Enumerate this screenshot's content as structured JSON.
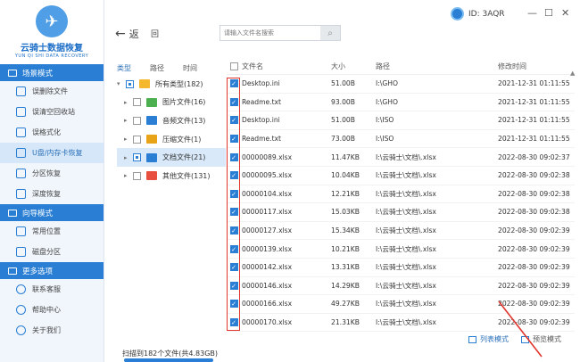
{
  "app": {
    "logo_title": "云骑士数据恢复",
    "logo_sub": "YUN QI SHI DATA RECOVERY",
    "user_id": "ID: 3AQR"
  },
  "sidebar": {
    "sections": [
      {
        "title": "场景模式",
        "items": [
          "误删除文件",
          "误清空回收站",
          "误格式化",
          "U盘/内存卡恢复",
          "分区恢复",
          "深度恢复"
        ]
      },
      {
        "title": "向导模式",
        "items": [
          "常用位置",
          "磁盘分区"
        ]
      },
      {
        "title": "更多选项",
        "items": [
          "联系客服",
          "帮助中心",
          "关于我们"
        ]
      }
    ]
  },
  "toolbar": {
    "back_label": "返",
    "back2_label": "回",
    "search_placeholder": "请输入文件名搜索"
  },
  "tree": {
    "headers": [
      "类型",
      "路径",
      "时间"
    ],
    "rows": [
      {
        "label": "所有类型(182)",
        "color": "#f5b72c"
      },
      {
        "label": "图片文件(16)",
        "color": "#4caf50"
      },
      {
        "label": "音频文件(13)",
        "color": "#2a7fd4"
      },
      {
        "label": "压缩文件(1)",
        "color": "#e8a317"
      },
      {
        "label": "文档文件(21)",
        "color": "#2a7fd4"
      },
      {
        "label": "其他文件(131)",
        "color": "#e94f3f"
      }
    ]
  },
  "table": {
    "headers": {
      "name": "文件名",
      "size": "大小",
      "path": "路径",
      "date": "修改时间"
    },
    "rows": [
      {
        "name": "Desktop.ini",
        "size": "51.00B",
        "path": "I:\\GHO",
        "date": "2021-12-31 01:11:55"
      },
      {
        "name": "Readme.txt",
        "size": "93.00B",
        "path": "I:\\GHO",
        "date": "2021-12-31 01:11:55"
      },
      {
        "name": "Desktop.ini",
        "size": "51.00B",
        "path": "I:\\ISO",
        "date": "2021-12-31 01:11:55"
      },
      {
        "name": "Readme.txt",
        "size": "73.00B",
        "path": "I:\\ISO",
        "date": "2021-12-31 01:11:55"
      },
      {
        "name": "00000089.xlsx",
        "size": "11.47KB",
        "path": "I:\\云骑士\\文档\\.xlsx",
        "date": "2022-08-30 09:02:37"
      },
      {
        "name": "00000095.xlsx",
        "size": "10.04KB",
        "path": "I:\\云骑士\\文档\\.xlsx",
        "date": "2022-08-30 09:02:38"
      },
      {
        "name": "00000104.xlsx",
        "size": "12.21KB",
        "path": "I:\\云骑士\\文档\\.xlsx",
        "date": "2022-08-30 09:02:38"
      },
      {
        "name": "00000117.xlsx",
        "size": "15.03KB",
        "path": "I:\\云骑士\\文档\\.xlsx",
        "date": "2022-08-30 09:02:38"
      },
      {
        "name": "00000127.xlsx",
        "size": "15.34KB",
        "path": "I:\\云骑士\\文档\\.xlsx",
        "date": "2022-08-30 09:02:39"
      },
      {
        "name": "00000139.xlsx",
        "size": "10.21KB",
        "path": "I:\\云骑士\\文档\\.xlsx",
        "date": "2022-08-30 09:02:39"
      },
      {
        "name": "00000142.xlsx",
        "size": "13.31KB",
        "path": "I:\\云骑士\\文档\\.xlsx",
        "date": "2022-08-30 09:02:39"
      },
      {
        "name": "00000146.xlsx",
        "size": "14.29KB",
        "path": "I:\\云骑士\\文档\\.xlsx",
        "date": "2022-08-30 09:02:39"
      },
      {
        "name": "00000166.xlsx",
        "size": "49.27KB",
        "path": "I:\\云骑士\\文档\\.xlsx",
        "date": "2022-08-30 09:02:39"
      },
      {
        "name": "00000170.xlsx",
        "size": "21.31KB",
        "path": "I:\\云骑士\\文档\\.xlsx",
        "date": "2022-08-30 09:02:39"
      }
    ]
  },
  "status": {
    "scan_text": "扫描到182个文件(共4.83GB)",
    "list_mode": "列表模式",
    "preview_mode": "预览模式"
  }
}
